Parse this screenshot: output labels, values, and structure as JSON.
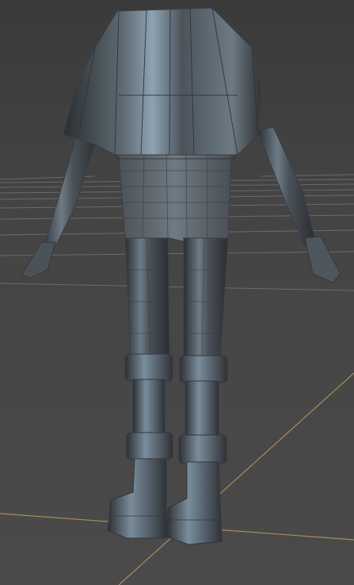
{
  "viewport": {
    "background": "#444444",
    "grid_line_color": "#8a8a8a",
    "axis_color": "#b89a5a",
    "mesh_color": "#4a4f55",
    "highlight_color": "#9fb3c4"
  },
  "model": {
    "parts": [
      "jacket",
      "left-arm",
      "right-arm",
      "pants",
      "left-leg",
      "right-leg",
      "left-boot",
      "right-boot"
    ]
  }
}
